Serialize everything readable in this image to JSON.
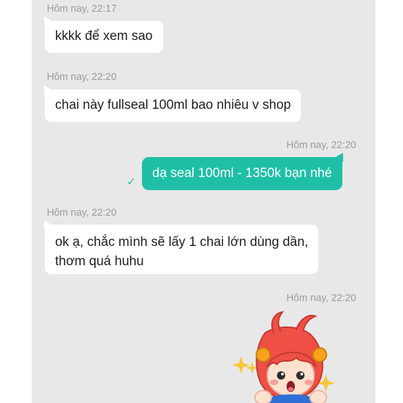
{
  "chat": {
    "messages": [
      {
        "side": "incoming",
        "time": "Hôm nay, 22:17",
        "text": "kkkk để xem sao"
      },
      {
        "side": "incoming",
        "time": "Hôm nay, 22:20",
        "text": "chai này fullseal 100ml bao nhiêu v shop"
      },
      {
        "side": "outgoing",
        "time": "Hôm nay, 22:20",
        "text": "dạ seal 100ml - 1350k bạn nhé",
        "status_icon": "check-icon"
      },
      {
        "side": "incoming",
        "time": "Hôm nay, 22:20",
        "lines": [
          "ok ạ, chắc mình sẽ lấy 1 chai lớn dùng dần,",
          "thơm quá huhu"
        ]
      },
      {
        "side": "outgoing",
        "time": "Hôm nay, 22:20",
        "sticker": "surprised-red-hair-girl-sticker"
      }
    ]
  },
  "colors": {
    "chat_background": "#e8e8e8",
    "incoming_bubble": "#ffffff",
    "outgoing_bubble": "#1fbfa7",
    "timestamp_text": "#9a9a9a"
  }
}
